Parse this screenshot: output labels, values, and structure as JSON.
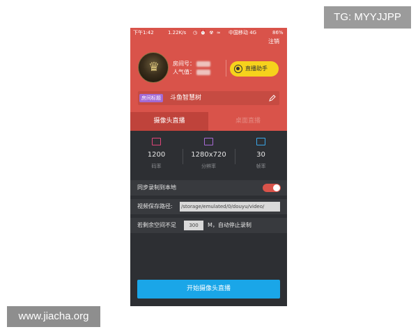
{
  "watermarks": {
    "top": "TG: MYYJJPP",
    "bottom": "www.jiacha.org"
  },
  "status_bar": {
    "time": "下午1:42",
    "speed": "1.22K/s",
    "icons": "◷ ⏰ ☢ ≈",
    "carrier": "中国移动 4G",
    "battery": "86%"
  },
  "header": {
    "logout_label": "注销",
    "room_number_label": "房间号：",
    "popularity_label": "人气值：",
    "assistant_button": "直播助手",
    "title_badge": "房间标题",
    "title_value": "斗鱼智慧树"
  },
  "tabs": [
    {
      "label": "摄像头直播",
      "active": true
    },
    {
      "label": "桌面直播",
      "active": false
    }
  ],
  "stats": [
    {
      "value": "1200",
      "label": "码率",
      "icon": "bitrate-icon",
      "color": "#e0457a"
    },
    {
      "value": "1280x720",
      "label": "分辨率",
      "icon": "resolution-icon",
      "color": "#a86ad6"
    },
    {
      "value": "30",
      "label": "帧率",
      "icon": "framerate-icon",
      "color": "#3aa7e8"
    }
  ],
  "settings": {
    "sync_record_label": "同步录制到本地",
    "sync_record_enabled": true,
    "save_path_label": "视频保存路径:",
    "save_path_value": "/storage/emulated/0/douyu/video/",
    "space_label": "若剩余空间不足",
    "space_value": "300",
    "space_suffix": "M，自动停止录制"
  },
  "start_button": "开始摄像头直播",
  "colors": {
    "brand_red": "#d9534a",
    "accent_yellow": "#f6d21c",
    "start_blue": "#1aa6e8"
  }
}
